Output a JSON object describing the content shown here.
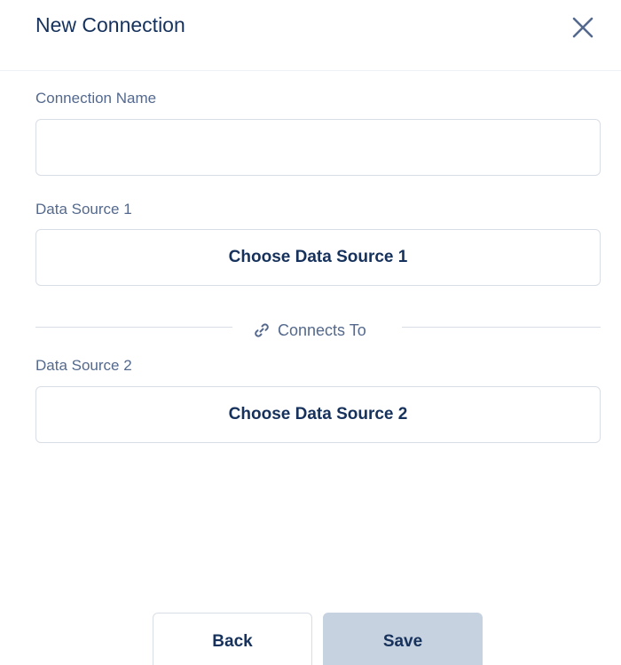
{
  "dialog": {
    "title": "New Connection",
    "close_icon": "close-icon"
  },
  "form": {
    "connection_name": {
      "label": "Connection Name",
      "value": "",
      "placeholder": ""
    },
    "data_source_1": {
      "label": "Data Source 1",
      "button_label": "Choose Data Source 1"
    },
    "separator": {
      "icon": "link-icon",
      "label": "Connects To"
    },
    "data_source_2": {
      "label": "Data Source 2",
      "button_label": "Choose Data Source 2"
    }
  },
  "footer": {
    "back_label": "Back",
    "save_label": "Save"
  },
  "colors": {
    "text": "#16325c",
    "label": "#54698d",
    "border": "#d8dde6",
    "save_disabled": "#c6d2e0"
  }
}
